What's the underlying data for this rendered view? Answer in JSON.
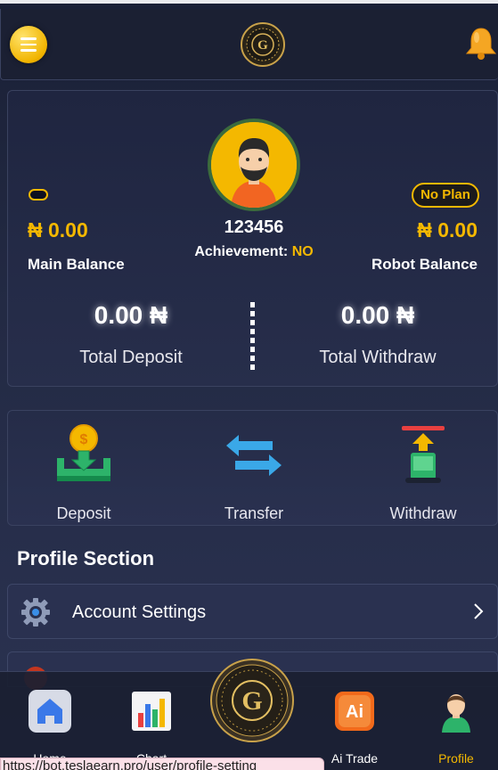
{
  "header": {
    "menu_icon": "hamburger-menu-icon",
    "logo_letter": "G",
    "bell_icon": "bell-icon"
  },
  "balance_card": {
    "user_id": "123456",
    "achievement_label": "Achievement:",
    "achievement_value": "NO",
    "plan_badge": "No Plan",
    "main_balance_amount": "₦ 0.00",
    "main_balance_label": "Main Balance",
    "robot_balance_amount": "₦ 0.00",
    "robot_balance_label": "Robot Balance",
    "total_deposit_amount": "0.00 ₦",
    "total_deposit_label": "Total Deposit",
    "total_withdraw_amount": "0.00 ₦",
    "total_withdraw_label": "Total Withdraw"
  },
  "actions": [
    {
      "label": "Deposit",
      "icon": "deposit-icon"
    },
    {
      "label": "Transfer",
      "icon": "transfer-arrows-icon"
    },
    {
      "label": "Withdraw",
      "icon": "withdraw-icon"
    }
  ],
  "profile_section": {
    "title": "Profile Section",
    "items": [
      {
        "label": "Account Settings",
        "icon": "gear-icon"
      }
    ]
  },
  "bottom_nav": {
    "items": [
      {
        "label": "Home",
        "icon": "home-icon"
      },
      {
        "label": "Chart",
        "icon": "chart-icon"
      },
      {
        "label": "Ai Trade",
        "icon": "ai-icon",
        "icon_text": "Ai"
      },
      {
        "label": "Profile",
        "icon": "profile-icon"
      }
    ],
    "active": "Profile"
  },
  "status_url": "https://bot.teslaearn.pro/user/profile-setting",
  "colors": {
    "accent": "#f4b800",
    "background": "#1a2036",
    "card": "#252c48"
  }
}
